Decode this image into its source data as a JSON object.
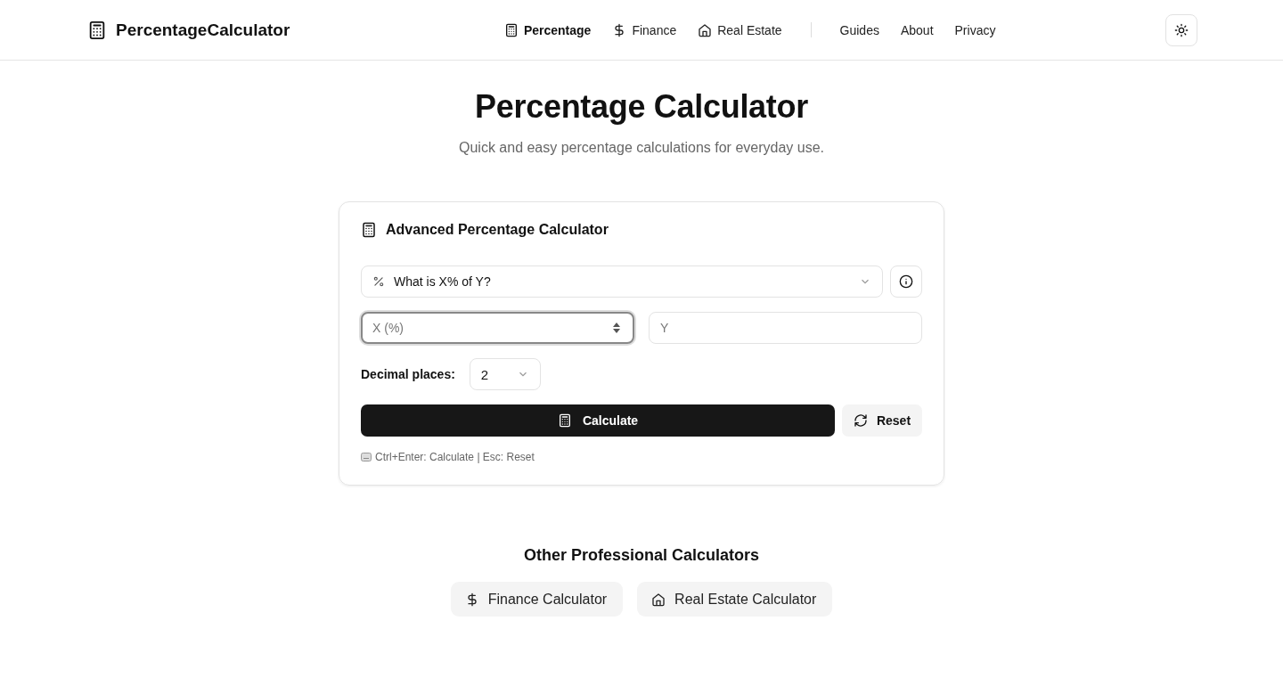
{
  "header": {
    "logo": "PercentageCalculator",
    "nav": [
      {
        "label": "Percentage",
        "kind": "calculator",
        "selected": true
      },
      {
        "label": "Finance",
        "kind": "dollar",
        "selected": false
      },
      {
        "label": "Real Estate",
        "kind": "home",
        "selected": false
      },
      {
        "label": "Guides",
        "kind": "text",
        "selected": false
      },
      {
        "label": "About",
        "kind": "text",
        "selected": false
      },
      {
        "label": "Privacy",
        "kind": "text",
        "selected": false
      }
    ]
  },
  "hero": {
    "title": "Percentage Calculator",
    "subtitle": "Quick and easy percentage calculations for everyday use."
  },
  "card": {
    "title": "Advanced Percentage Calculator",
    "mode": "What is X% of Y?",
    "inputs": [
      {
        "placeholder": "X (%)",
        "kind": "number",
        "focused": true
      },
      {
        "placeholder": "Y",
        "kind": "text",
        "focused": false
      }
    ],
    "decimal_label": "Decimal places:",
    "decimal_value": "2",
    "calculate": "Calculate",
    "reset": "Reset",
    "hint": "Ctrl+Enter: Calculate | Esc: Reset"
  },
  "other": {
    "title": "Other Professional Calculators",
    "links": [
      {
        "label": "Finance Calculator",
        "kind": "dollar"
      },
      {
        "label": "Real Estate Calculator",
        "kind": "home"
      }
    ]
  }
}
